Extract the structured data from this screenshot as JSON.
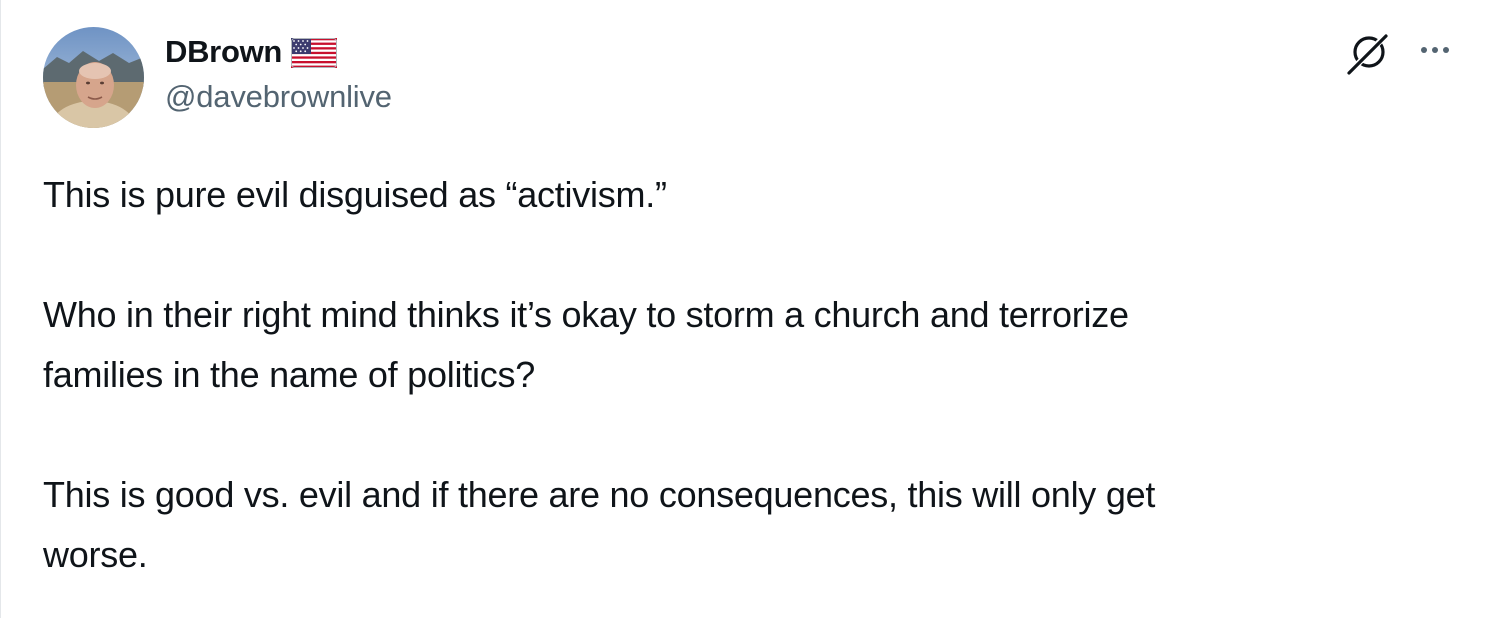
{
  "author": {
    "display_name": "DBrown",
    "flag_icon": "us-flag-icon",
    "handle": "@davebrownlive"
  },
  "actions": {
    "grok_icon": "grok-icon",
    "more_icon": "more-options-icon"
  },
  "tweet": {
    "lines": [
      "This is pure evil disguised as “activism.”",
      "",
      "Who in their right mind thinks it’s okay to storm a church and terrorize",
      "families in the name of politics?",
      "",
      "This is good vs. evil and if there are no consequences, this will only get",
      "worse."
    ]
  },
  "colors": {
    "text_primary": "#0f1419",
    "text_secondary": "#536471",
    "background": "#ffffff"
  }
}
